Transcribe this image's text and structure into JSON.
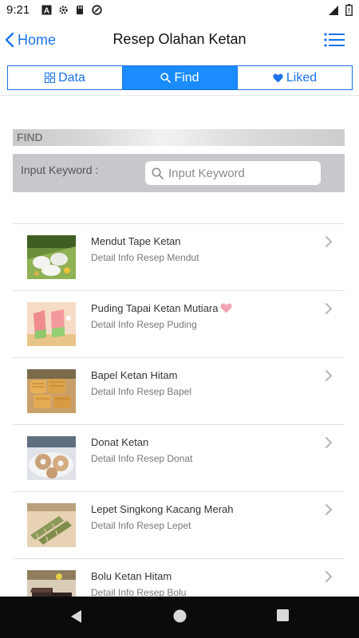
{
  "status_bar": {
    "time": "9:21"
  },
  "nav": {
    "back_label": "Home",
    "title": "Resep Olahan Ketan",
    "menu_icon": "list-icon"
  },
  "tabs": [
    {
      "label": "Data",
      "icon": "grid-icon",
      "active": false
    },
    {
      "label": "Find",
      "icon": "search-icon",
      "active": true
    },
    {
      "label": "Liked",
      "icon": "heart-icon",
      "active": false
    }
  ],
  "find": {
    "header": "FIND",
    "keyword_label": "Input Keyword :",
    "placeholder": "Input Keyword",
    "value": ""
  },
  "recipes": [
    {
      "title": "Mendut Tape Ketan",
      "subtitle": "Detail Info Resep Mendut",
      "liked": false
    },
    {
      "title": "Puding Tapai Ketan Mutiara",
      "subtitle": "Detail Info Resep Puding",
      "liked": true
    },
    {
      "title": "Bapel Ketan Hitam",
      "subtitle": "Detail Info Resep Bapel",
      "liked": false
    },
    {
      "title": "Donat Ketan",
      "subtitle": "Detail Info Resep Donat",
      "liked": false
    },
    {
      "title": "Lepet Singkong Kacang Merah",
      "subtitle": "Detail Info Resep Lepet",
      "liked": false
    },
    {
      "title": "Bolu Ketan Hitam",
      "subtitle": "Detail Info Resep Bolu",
      "liked": false
    }
  ],
  "colors": {
    "accent": "#1a73e8",
    "active_tab": "#1a8cff",
    "liked_heart": "#f4a3b4"
  }
}
